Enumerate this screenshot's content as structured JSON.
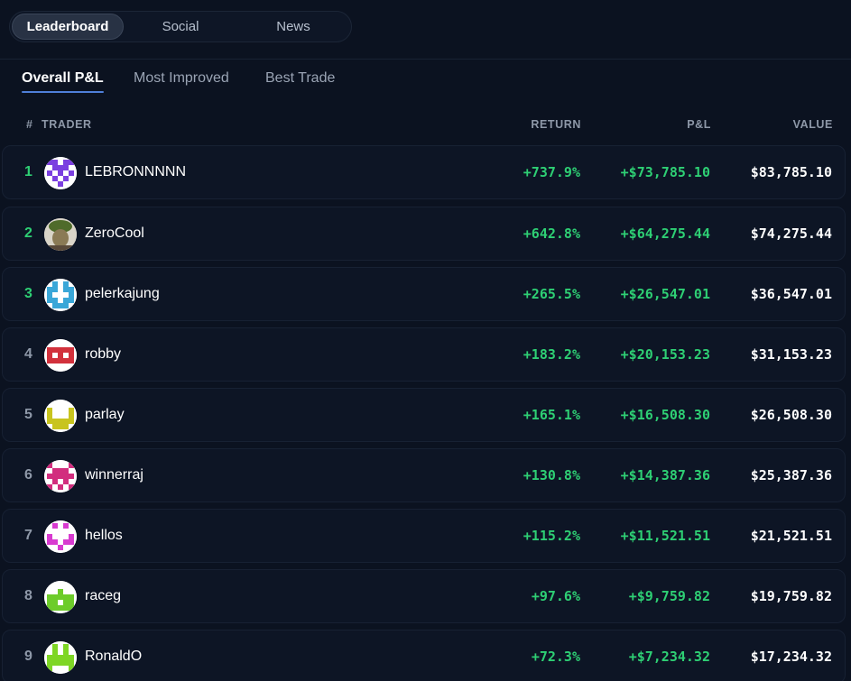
{
  "top_tabs": [
    {
      "label": "Leaderboard",
      "active": true
    },
    {
      "label": "Social",
      "active": false
    },
    {
      "label": "News",
      "active": false
    }
  ],
  "sub_tabs": [
    {
      "label": "Overall P&L",
      "active": true
    },
    {
      "label": "Most Improved",
      "active": false
    },
    {
      "label": "Best Trade",
      "active": false
    }
  ],
  "table": {
    "headers": {
      "rank": "#",
      "trader": "TRADER",
      "return": "RETURN",
      "pnl": "P&L",
      "value": "VALUE"
    },
    "rows": [
      {
        "rank": "1",
        "name": "LEBRONNNNN",
        "return": "+737.9%",
        "pnl": "+$73,785.10",
        "value": "$83,785.10",
        "avatar_color": "#7b3fe0",
        "avatar_icon": "purple-pixel-avatar-icon"
      },
      {
        "rank": "2",
        "name": "ZeroCool",
        "return": "+642.8%",
        "pnl": "+$64,275.44",
        "value": "$74,275.44",
        "avatar_color": "#8a7a55",
        "avatar_icon": "photo-avatar-icon"
      },
      {
        "rank": "3",
        "name": "pelerkajung",
        "return": "+265.5%",
        "pnl": "+$26,547.01",
        "value": "$36,547.01",
        "avatar_color": "#3aa7d8",
        "avatar_icon": "blue-pixel-avatar-icon"
      },
      {
        "rank": "4",
        "name": "robby",
        "return": "+183.2%",
        "pnl": "+$20,153.23",
        "value": "$31,153.23",
        "avatar_color": "#d2313c",
        "avatar_icon": "red-pixel-avatar-icon"
      },
      {
        "rank": "5",
        "name": "parlay",
        "return": "+165.1%",
        "pnl": "+$16,508.30",
        "value": "$26,508.30",
        "avatar_color": "#c8c41e",
        "avatar_icon": "yellow-pixel-avatar-icon"
      },
      {
        "rank": "6",
        "name": "winnerraj",
        "return": "+130.8%",
        "pnl": "+$14,387.36",
        "value": "$25,387.36",
        "avatar_color": "#d22d7e",
        "avatar_icon": "pink-pixel-avatar-icon"
      },
      {
        "rank": "7",
        "name": "hellos",
        "return": "+115.2%",
        "pnl": "+$11,521.51",
        "value": "$21,521.51",
        "avatar_color": "#d83ad0",
        "avatar_icon": "magenta-pixel-avatar-icon"
      },
      {
        "rank": "8",
        "name": "raceg",
        "return": "+97.6%",
        "pnl": "+$9,759.82",
        "value": "$19,759.82",
        "avatar_color": "#6dcc2a",
        "avatar_icon": "green-pixel-avatar-icon"
      },
      {
        "rank": "9",
        "name": "RonaldO",
        "return": "+72.3%",
        "pnl": "+$7,234.32",
        "value": "$17,234.32",
        "avatar_color": "#7ed624",
        "avatar_icon": "lime-pixel-avatar-icon"
      }
    ]
  },
  "colors": {
    "background": "#0b1220",
    "positive": "#2ecf74",
    "accent": "#4f7fd8"
  }
}
